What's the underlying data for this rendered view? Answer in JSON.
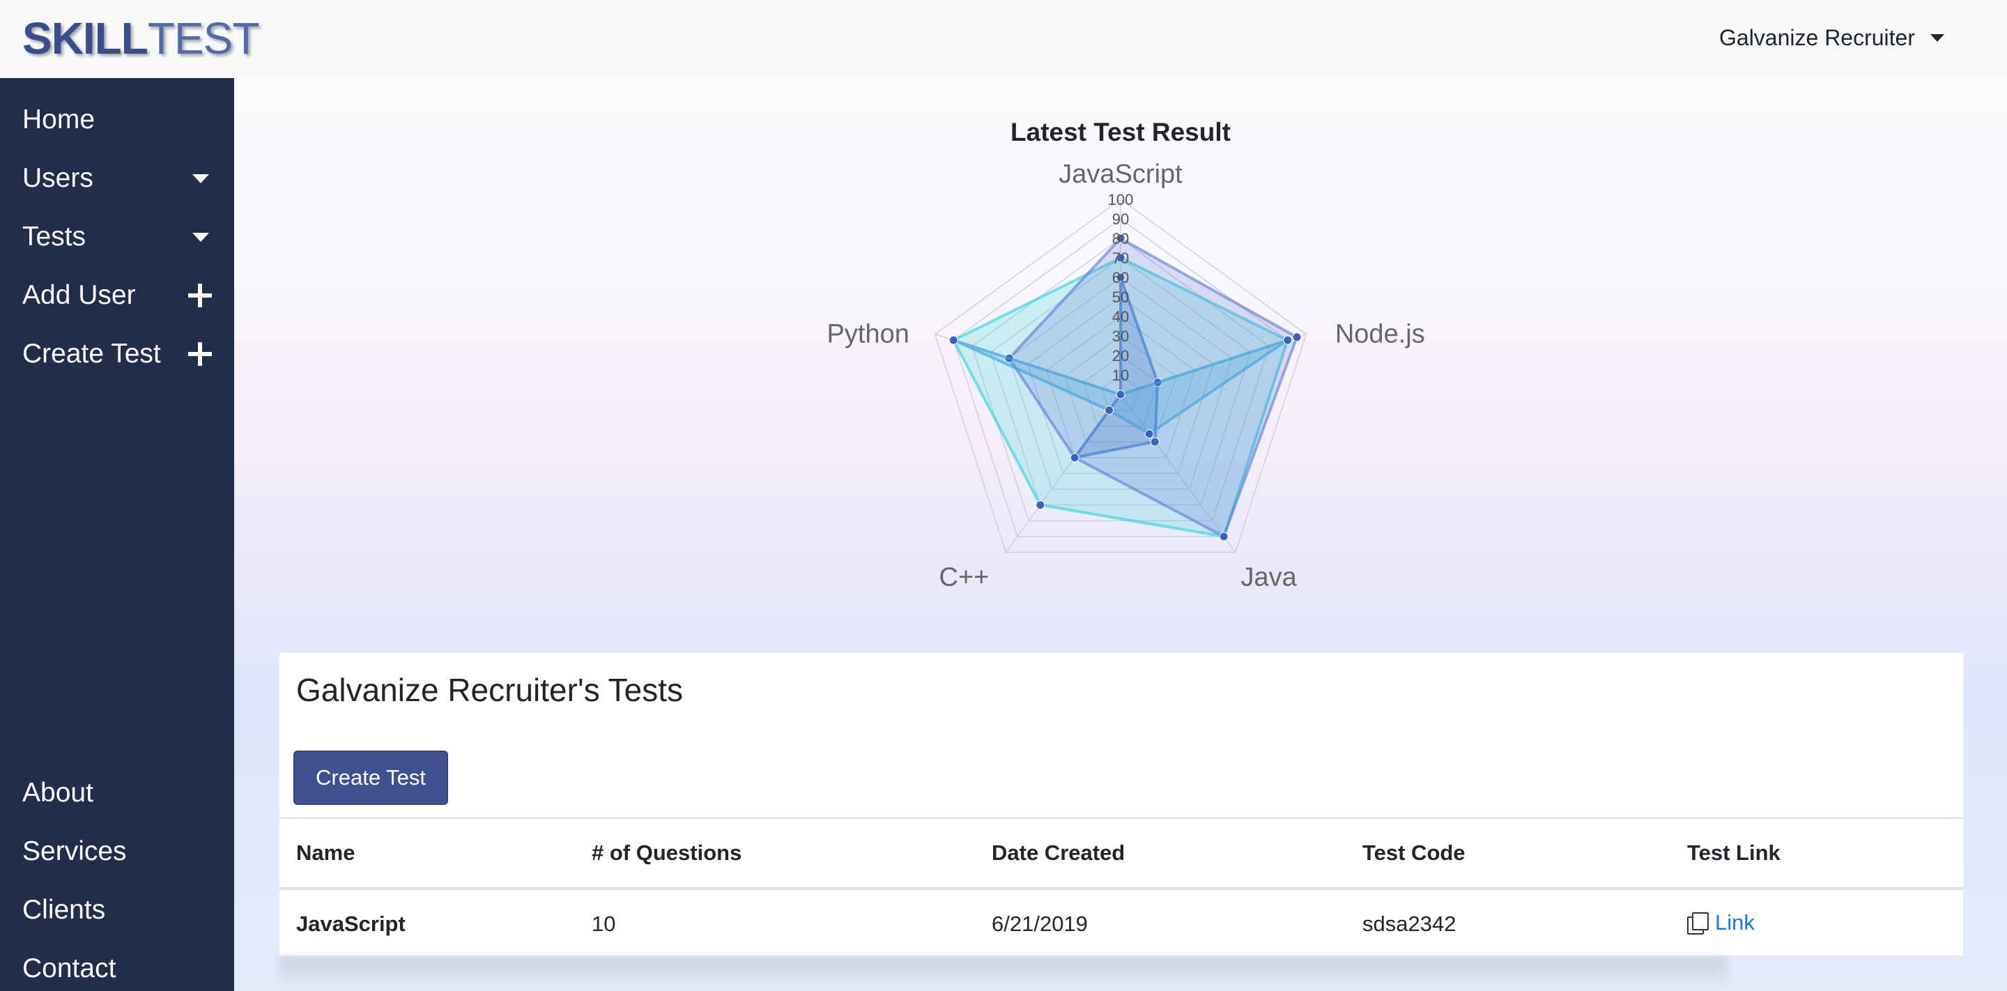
{
  "brand": {
    "part1": "SKILL",
    "part2": "TEST"
  },
  "user_menu": {
    "label": "Galvanize Recruiter"
  },
  "sidebar": {
    "top_items": [
      {
        "label": "Home"
      },
      {
        "label": "Users"
      },
      {
        "label": "Tests"
      },
      {
        "label": "Add User"
      },
      {
        "label": "Create Test"
      }
    ],
    "bottom_items": [
      {
        "label": "About"
      },
      {
        "label": "Services"
      },
      {
        "label": "Clients"
      },
      {
        "label": "Contact"
      }
    ]
  },
  "chart_data": {
    "type": "radar",
    "title": "Latest Test Result",
    "axes": [
      "JavaScript",
      "Node.js",
      "Java",
      "C++",
      "Python"
    ],
    "scale": {
      "min": 0,
      "max": 100,
      "step": 10,
      "ticks": [
        "10",
        "20",
        "30",
        "40",
        "50",
        "60",
        "70",
        "80",
        "90",
        "100"
      ]
    },
    "series": [
      {
        "values": [
          70,
          90,
          90,
          70,
          90
        ],
        "color": "#2ad4d8"
      },
      {
        "values": [
          80,
          95,
          90,
          40,
          60
        ],
        "color": "#5b78d8"
      },
      {
        "values": [
          60,
          20,
          30,
          40,
          0
        ],
        "color": "#3a6fc8"
      },
      {
        "values": [
          0,
          90,
          25,
          10,
          90
        ],
        "color": "#3d9fd8"
      }
    ]
  },
  "card": {
    "title": "Galvanize Recruiter's Tests",
    "create_button": "Create Test",
    "columns": [
      "Name",
      "# of Questions",
      "Date Created",
      "Test Code",
      "Test Link"
    ],
    "rows": [
      {
        "name": "JavaScript",
        "questions": "10",
        "date": "6/21/2019",
        "code": "sdsa2342",
        "link": "Link"
      }
    ]
  }
}
